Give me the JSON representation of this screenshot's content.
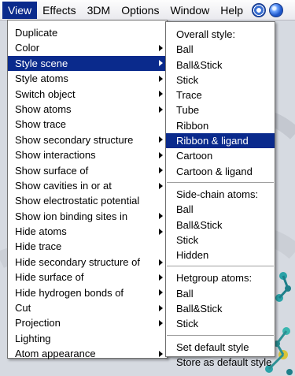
{
  "menubar": {
    "items": [
      {
        "label": "View",
        "active": true
      },
      {
        "label": "Effects"
      },
      {
        "label": "3DM"
      },
      {
        "label": "Options"
      },
      {
        "label": "Window"
      },
      {
        "label": "Help"
      }
    ],
    "icons": [
      "settings-gear-icon",
      "globe-sphere-icon"
    ]
  },
  "view_menu": {
    "items": [
      {
        "label": "Duplicate"
      },
      {
        "label": "Color",
        "submenu": true
      },
      {
        "label": "Style scene",
        "submenu": true,
        "highlighted": true
      },
      {
        "label": "Style atoms",
        "submenu": true
      },
      {
        "label": "Switch object",
        "submenu": true
      },
      {
        "label": "Show atoms",
        "submenu": true
      },
      {
        "label": "Show trace"
      },
      {
        "label": "Show secondary structure",
        "submenu": true
      },
      {
        "label": "Show interactions",
        "submenu": true
      },
      {
        "label": "Show surface of",
        "submenu": true
      },
      {
        "label": "Show cavities in or at",
        "submenu": true
      },
      {
        "label": "Show electrostatic potential"
      },
      {
        "label": "Show ion binding sites in",
        "submenu": true
      },
      {
        "label": "Hide atoms",
        "submenu": true
      },
      {
        "label": "Hide trace"
      },
      {
        "label": "Hide secondary structure of",
        "submenu": true
      },
      {
        "label": "Hide surface of",
        "submenu": true
      },
      {
        "label": "Hide hydrogen bonds of",
        "submenu": true
      },
      {
        "label": "Cut",
        "submenu": true
      },
      {
        "label": "Projection",
        "submenu": true
      },
      {
        "label": "Lighting"
      },
      {
        "label": "Atom appearance",
        "submenu": true
      }
    ]
  },
  "style_scene_submenu": {
    "overall_header": "Overall style:",
    "overall_items": [
      {
        "label": "Ball"
      },
      {
        "label": "Ball&Stick"
      },
      {
        "label": "Stick"
      },
      {
        "label": "Trace"
      },
      {
        "label": "Tube"
      },
      {
        "label": "Ribbon"
      },
      {
        "label": "Ribbon & ligand",
        "highlighted": true
      },
      {
        "label": "Cartoon"
      },
      {
        "label": "Cartoon & ligand"
      }
    ],
    "sidechain_header": "Side-chain atoms:",
    "sidechain_items": [
      {
        "label": "Ball"
      },
      {
        "label": "Ball&Stick"
      },
      {
        "label": "Stick"
      },
      {
        "label": "Hidden"
      }
    ],
    "hetgroup_header": "Hetgroup atoms:",
    "hetgroup_items": [
      {
        "label": "Ball"
      },
      {
        "label": "Ball&Stick"
      },
      {
        "label": "Stick"
      }
    ],
    "footer_items": [
      {
        "label": "Set default style"
      },
      {
        "label": "Store as default style"
      }
    ]
  },
  "colors": {
    "highlight": "#0a2a8c",
    "menu_bg": "#ffffff"
  }
}
